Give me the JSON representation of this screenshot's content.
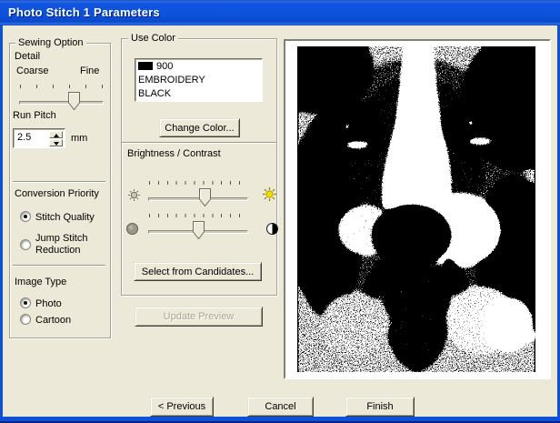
{
  "window": {
    "title": "Photo Stitch 1 Parameters"
  },
  "sewing": {
    "label": "Sewing Option",
    "detail": {
      "label": "Detail",
      "left_label": "Coarse",
      "right_label": "Fine",
      "value_pct": 65
    },
    "run_pitch": {
      "label": "Run Pitch",
      "value": "2.5",
      "unit": "mm"
    },
    "conversion": {
      "label": "Conversion Priority",
      "options": [
        {
          "label": "Stitch Quality",
          "selected": true
        },
        {
          "label": "Jump Stitch Reduction",
          "selected": false
        }
      ]
    },
    "image_type": {
      "label": "Image Type",
      "options": [
        {
          "label": "Photo",
          "selected": true
        },
        {
          "label": "Cartoon",
          "selected": false
        }
      ]
    }
  },
  "use_color": {
    "label": "Use Color",
    "thread": {
      "swatch_color": "#000000",
      "code": "900",
      "line2": "EMBROIDERY",
      "line3": "BLACK"
    },
    "change_color_button": "Change Color...",
    "bc_label": "Brightness / Contrast",
    "brightness": {
      "value_pct": 57
    },
    "contrast": {
      "value_pct": 50
    },
    "select_candidates_button": "Select from Candidates...",
    "update_preview_button": "Update Preview",
    "update_preview_disabled": true
  },
  "footer": {
    "previous_button": "< Previous",
    "cancel_button": "Cancel",
    "finish_button": "Finish"
  },
  "colors": {
    "dialog_bg": "#ECE9D8",
    "titlebar_blue": "#0D52DA",
    "window_border_blue": "#0D51D5",
    "bright_sun_yellow": "#F2DE00",
    "thread_swatch": "#000000"
  }
}
